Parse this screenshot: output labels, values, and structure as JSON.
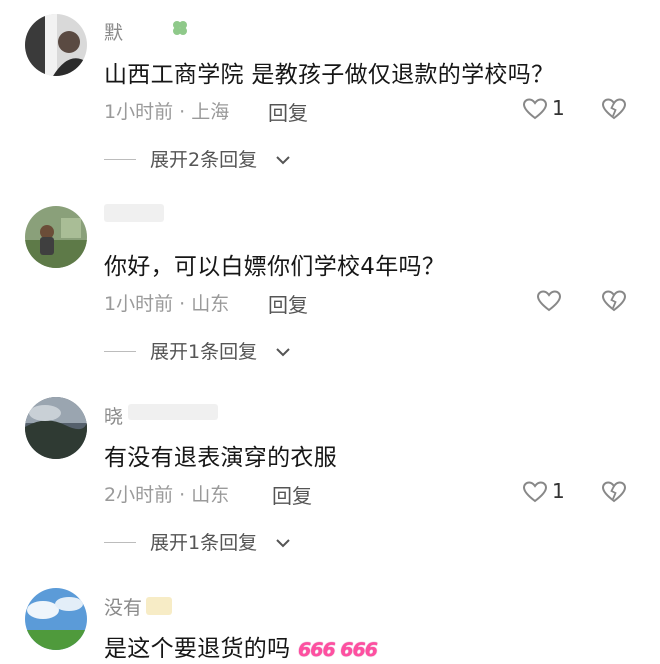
{
  "comments": [
    {
      "username": "默",
      "text": "山西工商学院 是教孩子做仅退款的学校吗？",
      "time": "1小时前",
      "location": "上海",
      "reply_label": "回复",
      "likes": "1",
      "expand_label": "展开2条回复"
    },
    {
      "username": "",
      "text": "你好，可以白嫖你们学校4年吗？",
      "time": "1小时前",
      "location": "山东",
      "reply_label": "回复",
      "likes": "",
      "expand_label": "展开1条回复"
    },
    {
      "username": "晓",
      "text": "有没有退表演穿的衣服",
      "time": "2小时前",
      "location": "山东",
      "reply_label": "回复",
      "likes": "1",
      "expand_label": "展开1条回复"
    },
    {
      "username": "没有",
      "text": "是这个要退货的吗",
      "emoji_text": "666 666"
    }
  ],
  "separator": " · ",
  "colors": {
    "text": "#161616",
    "meta": "#9a9a9a",
    "icon": "#888888",
    "emoji_pink": "#ff4fa0"
  },
  "icons": {
    "like": "heart-outline-icon",
    "dislike": "broken-heart-icon",
    "expand": "chevron-down-icon"
  }
}
